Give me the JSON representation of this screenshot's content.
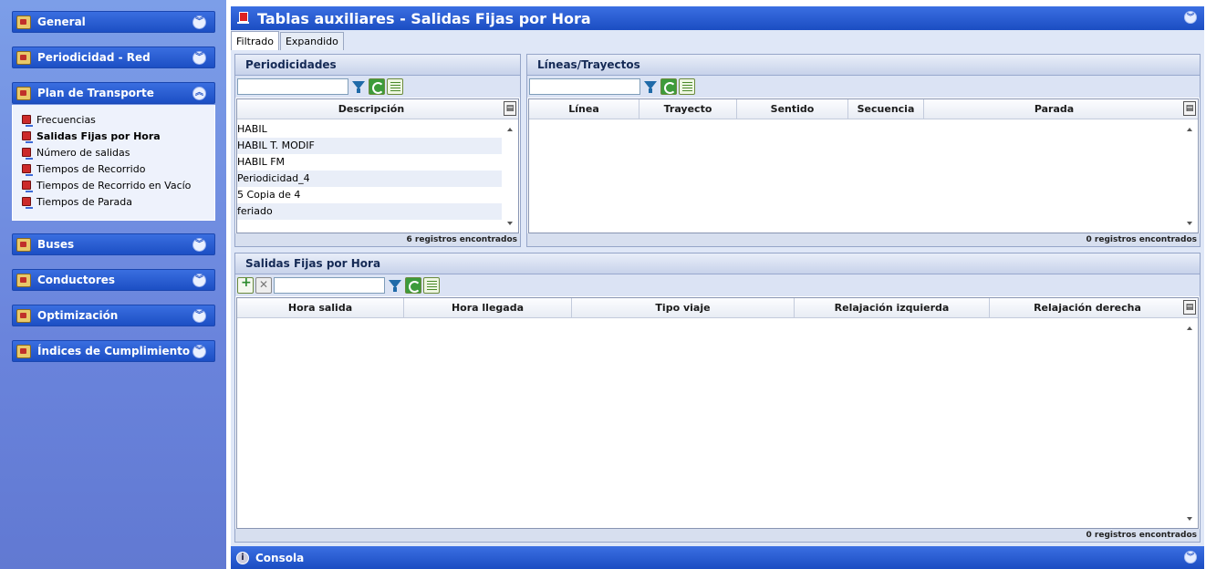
{
  "sidebar": {
    "sections": [
      {
        "label": "General",
        "expanded": false
      },
      {
        "label": "Periodicidad - Red",
        "expanded": false
      },
      {
        "label": "Plan de Transporte",
        "expanded": true
      },
      {
        "label": "Buses",
        "expanded": false
      },
      {
        "label": "Conductores",
        "expanded": false
      },
      {
        "label": "Optimización",
        "expanded": false
      },
      {
        "label": "Índices de Cumplimiento",
        "expanded": false
      }
    ],
    "plan_items": [
      {
        "label": "Frecuencias",
        "active": false
      },
      {
        "label": "Salidas Fijas por Hora",
        "active": true
      },
      {
        "label": "Número de salidas",
        "active": false
      },
      {
        "label": "Tiempos de Recorrido",
        "active": false
      },
      {
        "label": "Tiempos de Recorrido en Vacío",
        "active": false
      },
      {
        "label": "Tiempos de Parada",
        "active": false
      }
    ]
  },
  "main": {
    "title": "Tablas auxiliares - Salidas Fijas por Hora",
    "tabs": [
      {
        "label": "Filtrado",
        "selected": true
      },
      {
        "label": "Expandido",
        "selected": false
      }
    ],
    "periodicidades": {
      "title": "Periodicidades",
      "filter_value": "",
      "columns": [
        "Descripción"
      ],
      "rows": [
        "HABIL",
        "HABIL T. MODIF",
        "HABIL FM",
        "Periodicidad_4",
        "5 Copia de 4",
        "feriado"
      ],
      "footer": "6 registros encontrados"
    },
    "lineas": {
      "title": "Líneas/Trayectos",
      "filter_value": "",
      "columns": [
        "Línea",
        "Trayecto",
        "Sentido",
        "Secuencia",
        "Parada"
      ],
      "rows": [],
      "footer": "0 registros encontrados"
    },
    "salidas": {
      "title": "Salidas Fijas por Hora",
      "filter_value": "",
      "columns": [
        "Hora salida",
        "Hora llegada",
        "Tipo viaje",
        "Relajación izquierda",
        "Relajación derecha"
      ],
      "rows": [],
      "footer": "0 registros encontrados"
    },
    "console_label": "Consola"
  },
  "colors": {
    "header_blue": "#1f52c6",
    "sidebar_bg": "#7192e2",
    "panel_bg": "#dfe7f7",
    "row_alt": "#e9eef8"
  }
}
